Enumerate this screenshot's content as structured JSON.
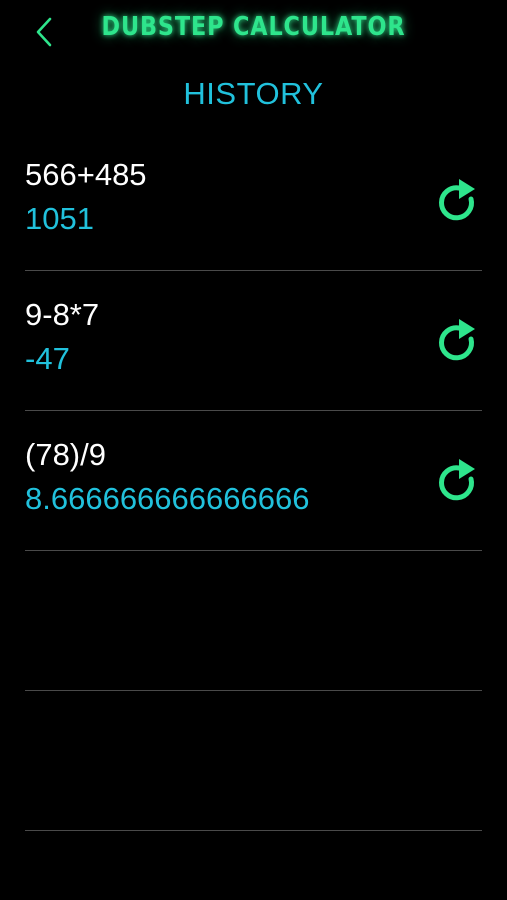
{
  "header": {
    "title": "DUBSTEP CALCULATOR",
    "back_icon": "chevron-left-icon"
  },
  "section": {
    "title": "HISTORY"
  },
  "colors": {
    "background": "#000000",
    "accent_green": "#2ee58c",
    "accent_cyan": "#21c1dc",
    "text_white": "#ffffff",
    "divider": "#4a4a4a"
  },
  "history": [
    {
      "expression": "566+485",
      "result": "1051",
      "icon": "reload-icon"
    },
    {
      "expression": "9-8*7",
      "result": "-47",
      "icon": "reload-icon"
    },
    {
      "expression": "(78)/9",
      "result": "8.666666666666666",
      "icon": "reload-icon"
    },
    {
      "expression": "",
      "result": ""
    },
    {
      "expression": "",
      "result": ""
    }
  ]
}
